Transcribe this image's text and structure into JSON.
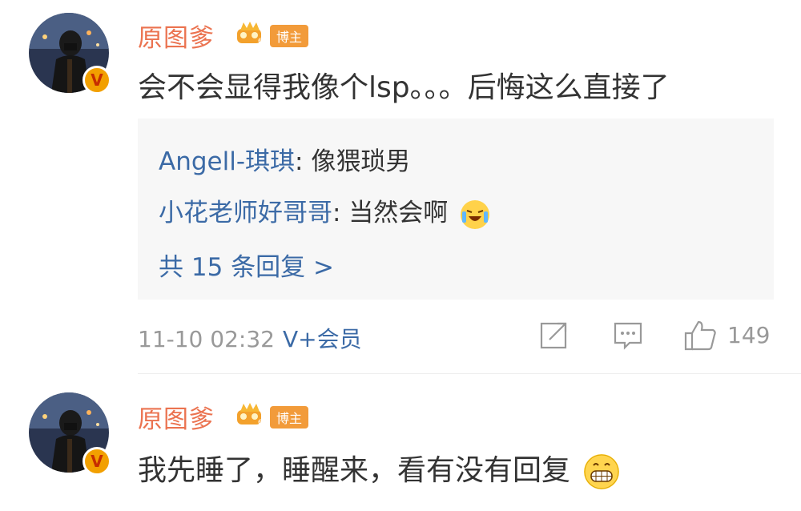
{
  "comments": [
    {
      "username": "原图爹",
      "badge_label": "博主",
      "text": "会不会显得我像个lsp。。。后悔这么直接了",
      "replies": [
        {
          "name": "Angell-琪琪",
          "text": ": 像猥琐男"
        },
        {
          "name": "小花老师好哥哥",
          "text": ": 当然会啊"
        }
      ],
      "more_replies": "共 15 条回复 >",
      "time": "11-10 02:32",
      "vip": "V+会员",
      "likes": "149"
    },
    {
      "username": "原图爹",
      "badge_label": "博主",
      "text": "我先睡了，睡醒来，看有没有回复"
    }
  ],
  "colors": {
    "username": "#eb7350",
    "link": "#3b6aa6",
    "badge": "#f29b3a",
    "meta": "#999999"
  },
  "icons": [
    "avatar",
    "verified-v-icon",
    "crown-level-icon",
    "share-icon",
    "comment-icon",
    "like-icon",
    "laughing-tears-emoji",
    "grin-emoji"
  ]
}
